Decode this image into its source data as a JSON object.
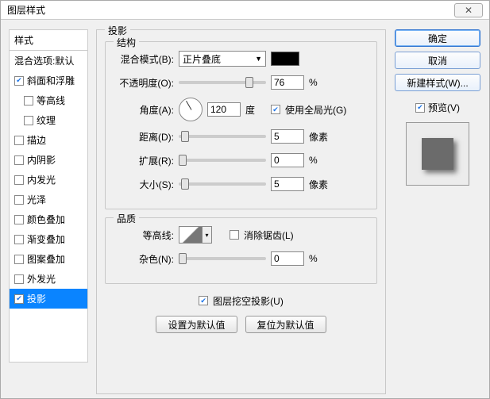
{
  "window": {
    "title": "图层样式",
    "close": "✕"
  },
  "sidebar": {
    "header": "样式",
    "items": [
      {
        "label": "混合选项:默认",
        "checked": null,
        "indent": false
      },
      {
        "label": "斜面和浮雕",
        "checked": true,
        "indent": false
      },
      {
        "label": "等高线",
        "checked": false,
        "indent": true
      },
      {
        "label": "纹理",
        "checked": false,
        "indent": true
      },
      {
        "label": "描边",
        "checked": false,
        "indent": false
      },
      {
        "label": "内阴影",
        "checked": false,
        "indent": false
      },
      {
        "label": "内发光",
        "checked": false,
        "indent": false
      },
      {
        "label": "光泽",
        "checked": false,
        "indent": false
      },
      {
        "label": "颜色叠加",
        "checked": false,
        "indent": false
      },
      {
        "label": "渐变叠加",
        "checked": false,
        "indent": false
      },
      {
        "label": "图案叠加",
        "checked": false,
        "indent": false
      },
      {
        "label": "外发光",
        "checked": false,
        "indent": false
      },
      {
        "label": "投影",
        "checked": true,
        "indent": false,
        "selected": true
      }
    ]
  },
  "panel": {
    "title": "投影",
    "structure": {
      "title": "结构",
      "blend_mode_label": "混合模式(B):",
      "blend_mode_value": "正片叠底",
      "opacity_label": "不透明度(O):",
      "opacity_value": "76",
      "opacity_unit": "%",
      "angle_label": "角度(A):",
      "angle_value": "120",
      "angle_unit": "度",
      "global_light_label": "使用全局光(G)",
      "global_light_checked": true,
      "distance_label": "距离(D):",
      "distance_value": "5",
      "distance_unit": "像素",
      "spread_label": "扩展(R):",
      "spread_value": "0",
      "spread_unit": "%",
      "size_label": "大小(S):",
      "size_value": "5",
      "size_unit": "像素"
    },
    "quality": {
      "title": "品质",
      "contour_label": "等高线:",
      "antialias_label": "消除锯齿(L)",
      "antialias_checked": false,
      "noise_label": "杂色(N):",
      "noise_value": "0",
      "noise_unit": "%"
    },
    "knockout_label": "图层挖空投影(U)",
    "knockout_checked": true,
    "make_default": "设置为默认值",
    "reset_default": "复位为默认值"
  },
  "buttons": {
    "ok": "确定",
    "cancel": "取消",
    "new_style": "新建样式(W)...",
    "preview_label": "预览(V)",
    "preview_checked": true
  }
}
